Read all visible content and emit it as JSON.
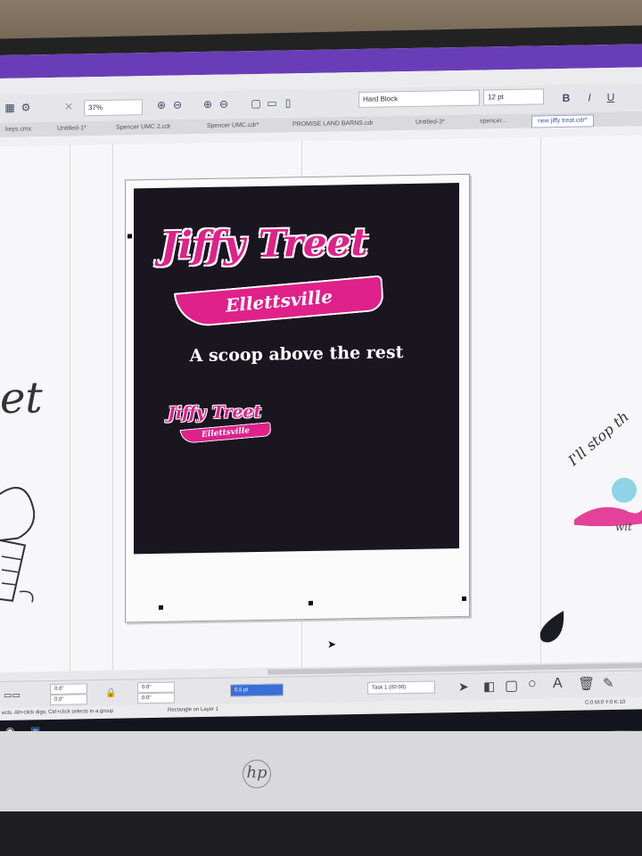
{
  "toolbar": {
    "zoom_value": "37%",
    "font_name": "Hard Block",
    "font_size": "12 pt",
    "style_buttons": [
      "B",
      "I",
      "U"
    ]
  },
  "tabs": [
    {
      "label": "keys.cmx"
    },
    {
      "label": "Untitled-1*"
    },
    {
      "label": "Spencer UMC 2.cdr"
    },
    {
      "label": "Spencer UMC.cdr*"
    },
    {
      "label": "PROMISE LAND BARNS.cdr"
    },
    {
      "label": "Untitled-3*"
    },
    {
      "label": "spencer..."
    },
    {
      "label": "new jiffy treat.cdr*"
    }
  ],
  "design": {
    "brand_name": "Jiffy Treet",
    "banner_text": "Ellettsville",
    "tagline": "A scoop above the rest",
    "mini_brand": "Jiffy Treet",
    "mini_banner": "Ellettsville"
  },
  "side_art": {
    "left_text": "et",
    "right_text": "I'll stop th",
    "right_small": "wit"
  },
  "propbar": {
    "pos_x": "0.0\"",
    "pos_y": "0.0\"",
    "size_w": "0.0\"",
    "size_h": "0.0\"",
    "outline": "0.5 pt",
    "task": "Task 1 (00:00)"
  },
  "status": {
    "hint": "ects. Alt+click digs; Ctrl+click selects in a group",
    "object": "Rectangle on Layer 1",
    "color": "C:0 M:0 Y:0 K:10"
  },
  "monitor": {
    "brand": "hp"
  },
  "colors": {
    "brand_pink": "#e0218a",
    "design_bg": "#1a1620",
    "title_purple": "#6a3db8"
  }
}
